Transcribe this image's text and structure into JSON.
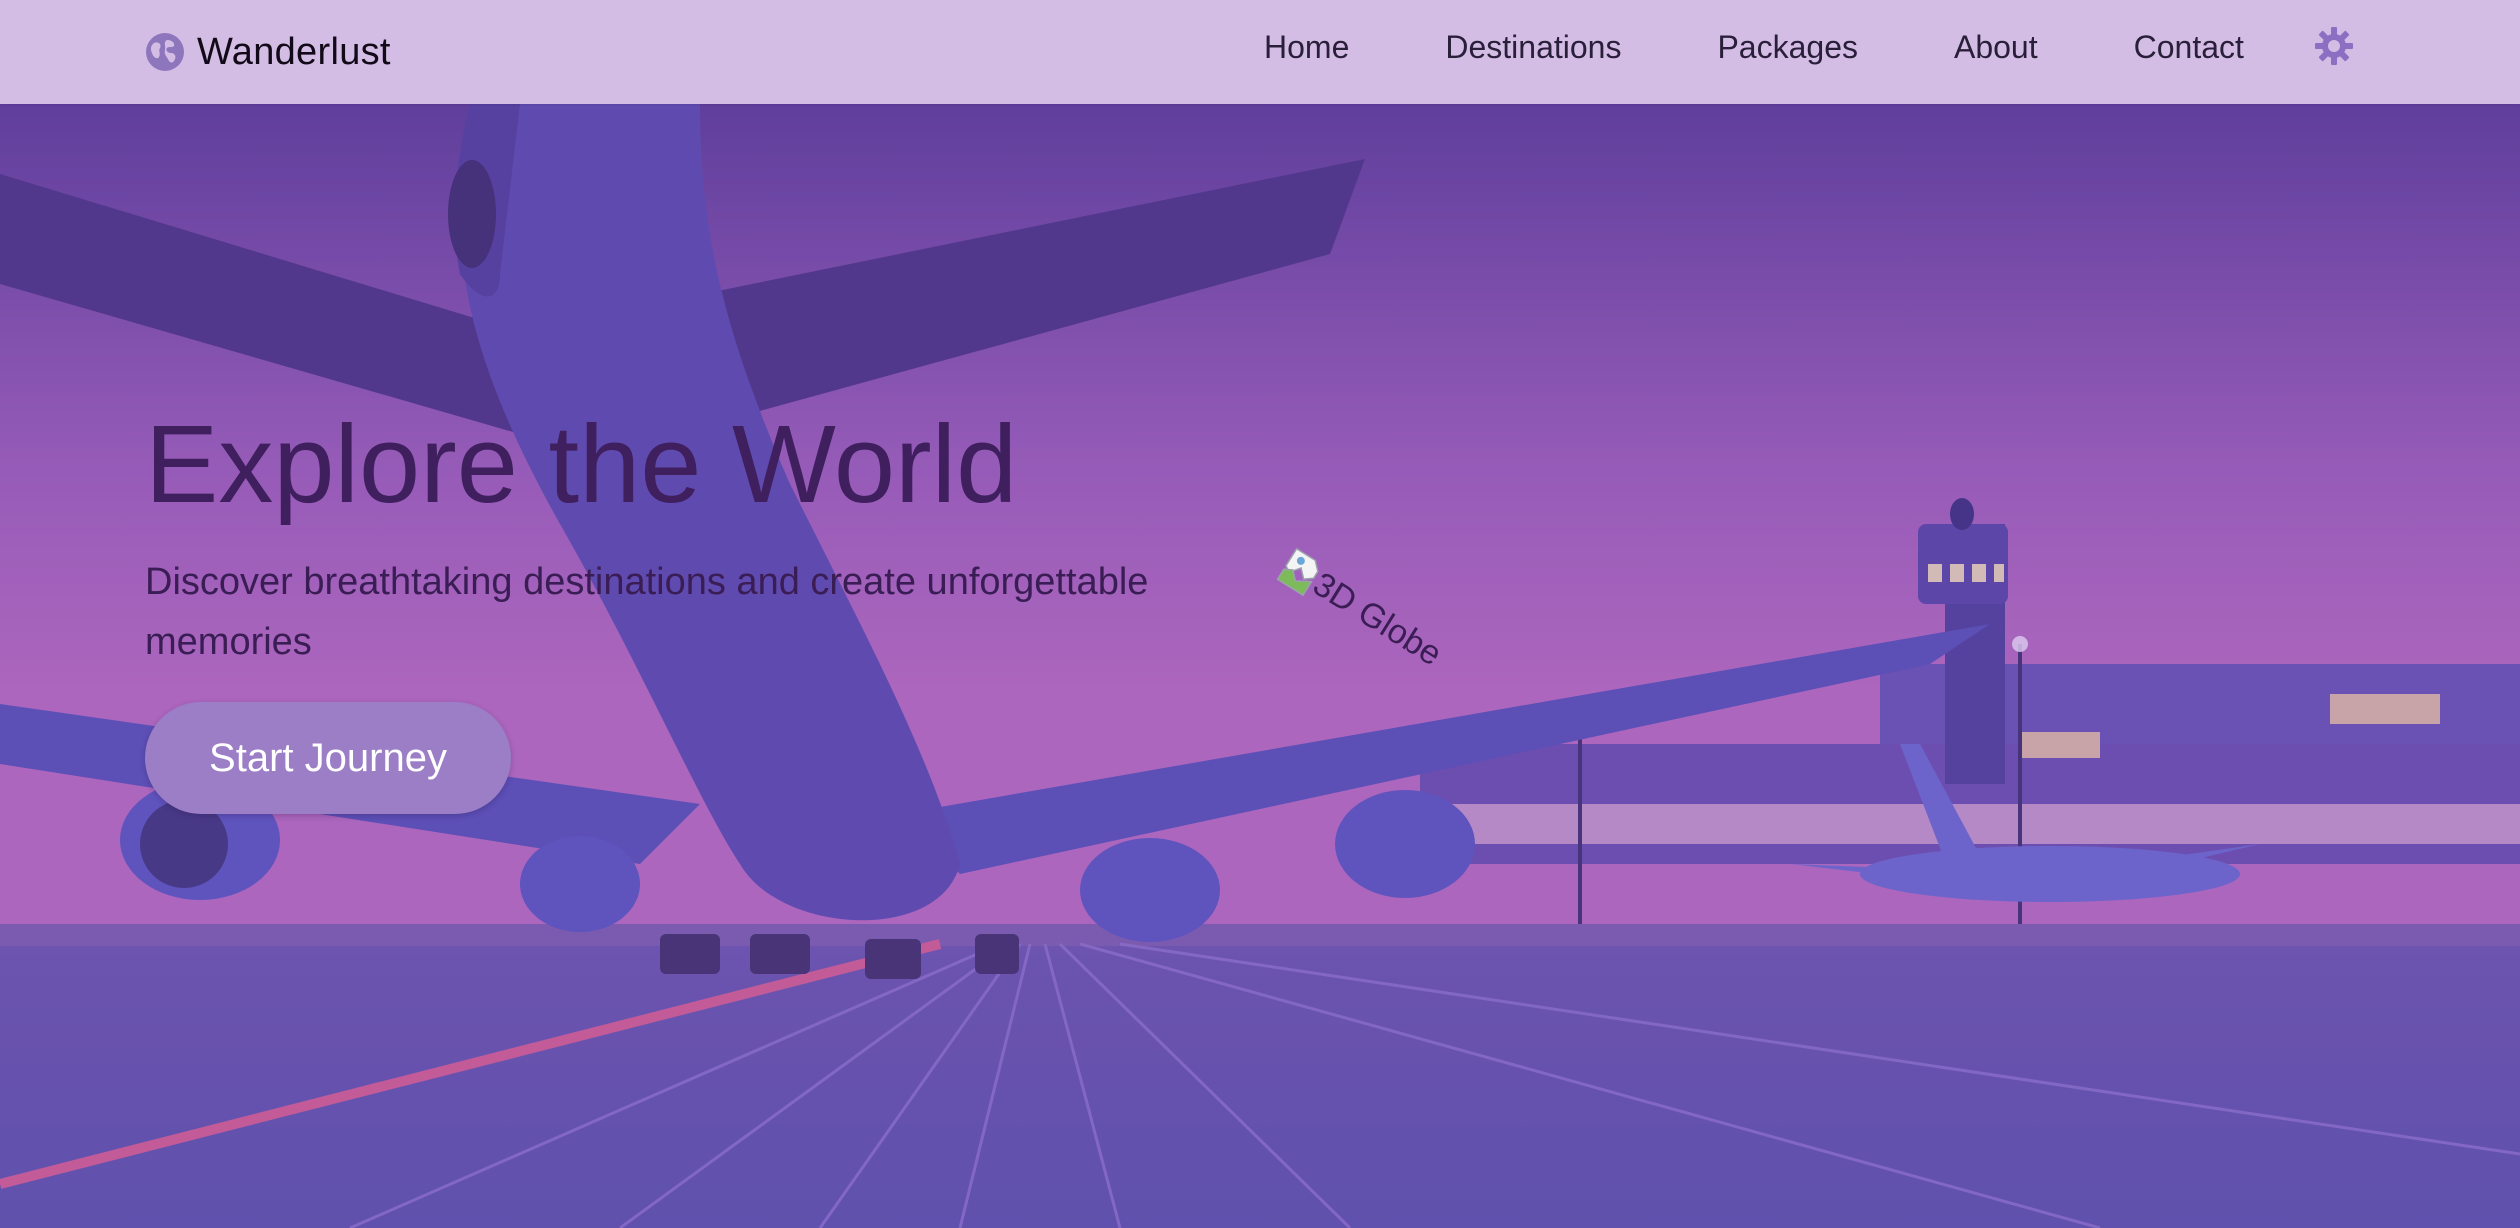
{
  "brand": {
    "name": "Wanderlust",
    "icon": "globe-icon"
  },
  "nav": {
    "links": [
      {
        "label": "Home"
      },
      {
        "label": "Destinations"
      },
      {
        "label": "Packages"
      },
      {
        "label": "About"
      },
      {
        "label": "Contact"
      }
    ],
    "settings_icon": "gear-icon"
  },
  "hero": {
    "title": "Explore the World",
    "subtitle": "Discover breathtaking destinations and create unforgettable memories",
    "cta_label": "Start Journey",
    "globe_alt": "3D Globe",
    "broken_image_icon": "broken-image-icon"
  },
  "colors": {
    "navbar_bg": "#d4bde4",
    "hero_overlay": "#7a4fb3",
    "title_text": "#3f1f5e",
    "cta_bg": "#9b7ec6",
    "cta_text": "#ffffff",
    "accent": "#8c6fc2"
  }
}
